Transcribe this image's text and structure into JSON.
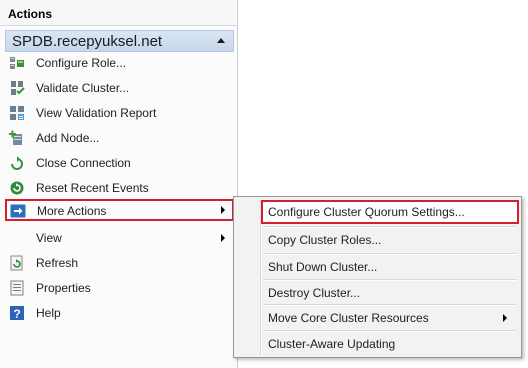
{
  "pane": {
    "title": "Actions",
    "group_title": "SPDB.recepyuksel.net"
  },
  "actions": [
    {
      "label": "Configure Role...",
      "icon": "configure-role-icon"
    },
    {
      "label": "Validate Cluster...",
      "icon": "validate-cluster-icon"
    },
    {
      "label": "View Validation Report",
      "icon": "validation-report-icon"
    },
    {
      "label": "Add Node...",
      "icon": "add-node-icon"
    },
    {
      "label": "Close Connection",
      "icon": "close-connection-icon"
    },
    {
      "label": "Reset Recent Events",
      "icon": "reset-events-icon"
    },
    {
      "label": "More Actions",
      "icon": "more-actions-icon",
      "submenu": true
    },
    {
      "label": "View",
      "icon": "",
      "submenu": true
    },
    {
      "label": "Refresh",
      "icon": "refresh-icon"
    },
    {
      "label": "Properties",
      "icon": "properties-icon"
    },
    {
      "label": "Help",
      "icon": "help-icon"
    }
  ],
  "submenu": [
    {
      "label": "Configure Cluster Quorum Settings..."
    },
    {
      "label": "Copy Cluster Roles..."
    },
    {
      "label": "Shut Down Cluster..."
    },
    {
      "label": "Destroy Cluster..."
    },
    {
      "label": "Move Core Cluster Resources",
      "submenu": true
    },
    {
      "label": "Cluster-Aware Updating"
    }
  ],
  "colors": {
    "highlight_border": "#d4202c",
    "group_header": "#c6d7ec",
    "menu_background": "#f2f2f2"
  }
}
